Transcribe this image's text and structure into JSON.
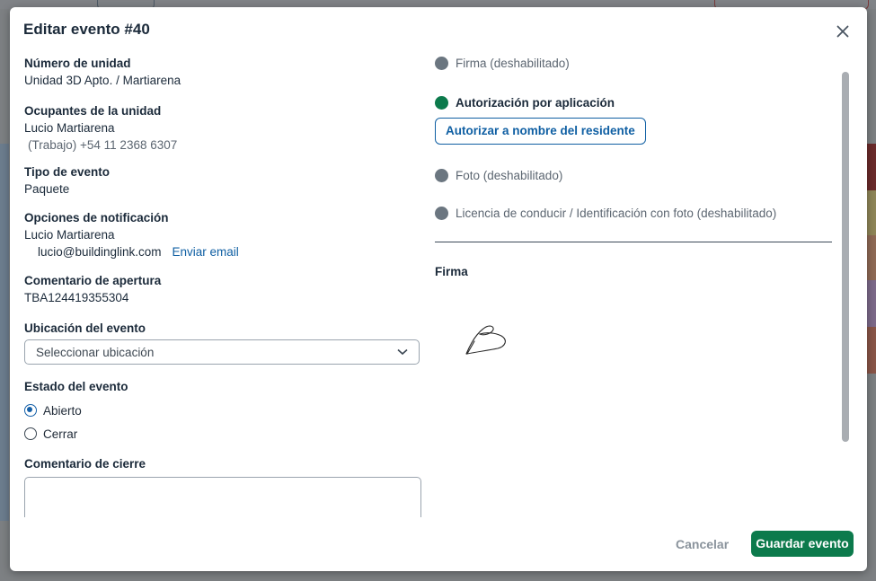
{
  "modal": {
    "title": "Editar evento #40"
  },
  "fields": {
    "unit_label": "Número de unidad",
    "unit_value": "Unidad 3D Apto. / Martiarena",
    "occupants_label": "Ocupantes de la unidad",
    "occupant_name": "Lucio Martiarena",
    "occupant_phone": "(Trabajo) +54 11 2368 6307",
    "event_type_label": "Tipo de evento",
    "event_type_value": "Paquete",
    "notify_label": "Opciones de notificación",
    "notify_name": "Lucio Martiarena",
    "notify_email": "lucio@buildinglink.com",
    "send_email_link": "Enviar email",
    "opening_comment_label": "Comentario de apertura",
    "opening_comment_value": "TBA124419355304",
    "location_label": "Ubicación del evento",
    "location_placeholder": "Seleccionar ubicación",
    "status_label": "Estado del evento",
    "status_options": [
      "Abierto",
      "Cerrar"
    ],
    "status_selected": "Abierto",
    "closing_comment_label": "Comentario de cierre",
    "closing_comment_value": ""
  },
  "pickup": {
    "options": [
      {
        "label": "Firma (deshabilitado)",
        "state": "disabled"
      },
      {
        "label": "Autorización por aplicación",
        "state": "active"
      },
      {
        "label": "Foto (deshabilitado)",
        "state": "disabled"
      },
      {
        "label": "Licencia de conducir / Identificación con foto (deshabilitado)",
        "state": "disabled"
      }
    ],
    "authorize_button": "Autorizar a nombre del residente",
    "signature_label": "Firma"
  },
  "footer": {
    "cancel_label": "Cancelar",
    "save_label": "Guardar evento"
  },
  "colors": {
    "primary_green": "#0c7a4c",
    "link_blue": "#0f5fa3",
    "disabled_gray": "#6b7680"
  },
  "icons": [
    "close-icon",
    "chevron-down-icon",
    "status-dot-icon"
  ]
}
